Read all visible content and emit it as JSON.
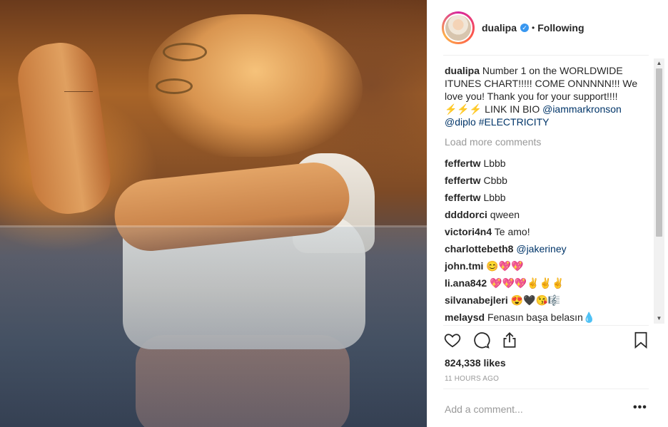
{
  "post": {
    "username": "dualipa",
    "verified": true,
    "follow_separator": "•",
    "follow_status": "Following",
    "caption": {
      "text": "Number 1 on the WORLDWIDE ITUNES CHART!!!!! COME ONNNNN!!! We love you! Thank you for your support!!!! ⚡⚡⚡ LINK IN BIO",
      "mentions": [
        "@iammarkronson",
        "@diplo"
      ],
      "hashtag": "#ELECTRICITY"
    },
    "load_more_label": "Load more comments",
    "comments": [
      {
        "user": "feffertw",
        "text": "Lbbb"
      },
      {
        "user": "feffertw",
        "text": "Cbbb"
      },
      {
        "user": "feffertw",
        "text": "Lbbb"
      },
      {
        "user": "ddddorci",
        "text": "qween"
      },
      {
        "user": "victori4n4",
        "text": "Te amo!"
      },
      {
        "user": "charlottebeth8",
        "text": "@jakeriney"
      },
      {
        "user": "john.tmi",
        "text": "😊💖💖"
      },
      {
        "user": "li.ana842",
        "text": "💖💖💖✌✌✌"
      },
      {
        "user": "silvanabejleri",
        "text": "😍🖤😘🎼"
      },
      {
        "user": "melaysd",
        "text": "Fenasın başa belasın💧"
      }
    ],
    "likes": "824,338 likes",
    "time_ago": "11 HOURS AGO",
    "add_comment_placeholder": "Add a comment...",
    "more_options": "•••"
  },
  "icons": {
    "like": "heart-icon",
    "comment": "comment-bubble-icon",
    "share": "share-icon",
    "save": "bookmark-icon",
    "verified": "verified-badge-icon"
  },
  "colors": {
    "link": "#003569",
    "verified": "#3897f0",
    "muted": "#999999",
    "text": "#262626"
  }
}
